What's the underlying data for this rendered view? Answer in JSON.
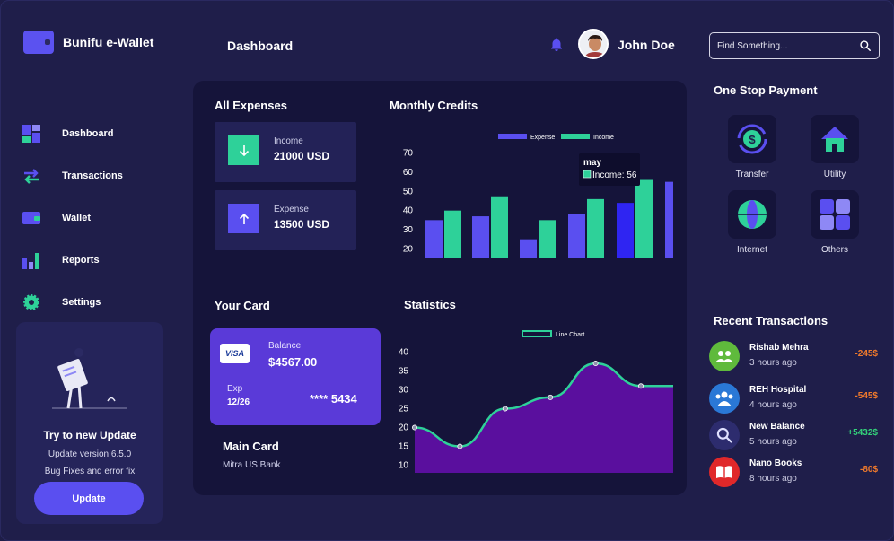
{
  "app": {
    "title": "Bunifu e-Wallet"
  },
  "header": {
    "page_title": "Dashboard",
    "user_name": "John Doe",
    "search_placeholder": "Find Something..."
  },
  "sidebar": {
    "items": [
      {
        "label": "Dashboard",
        "icon": "dashboard-icon"
      },
      {
        "label": "Transactions",
        "icon": "transactions-icon"
      },
      {
        "label": "Wallet",
        "icon": "wallet-icon"
      },
      {
        "label": "Reports",
        "icon": "reports-icon"
      },
      {
        "label": "Settings",
        "icon": "settings-icon"
      }
    ],
    "update_card": {
      "title": "Try to new Update",
      "version": "Update version 6.5.0",
      "note": "Bug Fixes and error fix",
      "button": "Update"
    }
  },
  "expenses": {
    "title": "All Expenses",
    "income": {
      "label": "Income",
      "value": "21000 USD"
    },
    "expense": {
      "label": "Expense",
      "value": "13500 USD"
    }
  },
  "card": {
    "section_title": "Your Card",
    "brand": "VISA",
    "balance_label": "Balance",
    "balance": "$4567.00",
    "exp_label": "Exp",
    "exp": "12/26",
    "number": "**** 5434",
    "name": "Main Card",
    "bank": "Mitra US Bank"
  },
  "one_stop": {
    "title": "One Stop Payment",
    "items": [
      {
        "label": "Transfer",
        "icon": "transfer-icon"
      },
      {
        "label": "Utility",
        "icon": "utility-icon"
      },
      {
        "label": "Internet",
        "icon": "internet-icon"
      },
      {
        "label": "Others",
        "icon": "others-icon"
      }
    ]
  },
  "recent": {
    "title": "Recent Transactions",
    "items": [
      {
        "name": "Rishab Mehra",
        "time": "3 hours ago",
        "amount": "-245$",
        "color": "#f07a2c"
      },
      {
        "name": "REH Hospital",
        "time": "4 hours ago",
        "amount": "-545$",
        "color": "#f07a2c"
      },
      {
        "name": "New Balance",
        "time": "5 hours ago",
        "amount": "+5432$",
        "color": "#33d17a"
      },
      {
        "name": "Nano Books",
        "time": "8 hours ago",
        "amount": "-80$",
        "color": "#f07a2c"
      }
    ]
  },
  "colors": {
    "expense": "#5a4ff0",
    "income": "#2ed199",
    "accent": "#5a4ff0",
    "area": "#5a0f9e",
    "line": "#2ed199"
  },
  "chart_data": [
    {
      "type": "bar",
      "title": "Monthly Credits",
      "legend": [
        "Expense",
        "Income"
      ],
      "legend_position": "top",
      "y_ticks": [
        20,
        30,
        40,
        50,
        60,
        70
      ],
      "ylim": [
        15,
        75
      ],
      "series": [
        {
          "name": "Expense",
          "values": [
            35,
            37,
            25,
            38,
            44,
            55
          ]
        },
        {
          "name": "Income",
          "values": [
            40,
            47,
            35,
            46,
            56,
            null
          ]
        }
      ],
      "tooltip": {
        "title": "may",
        "text": "Income: 56"
      }
    },
    {
      "type": "area",
      "title": "Statistics",
      "legend": [
        "Line Chart"
      ],
      "legend_position": "top",
      "y_ticks": [
        10,
        15,
        20,
        25,
        30,
        35,
        40
      ],
      "ylim": [
        8,
        42
      ],
      "x": [
        0,
        1,
        2,
        3,
        4,
        5
      ],
      "values": [
        20,
        15,
        25,
        28,
        37,
        31
      ]
    }
  ]
}
